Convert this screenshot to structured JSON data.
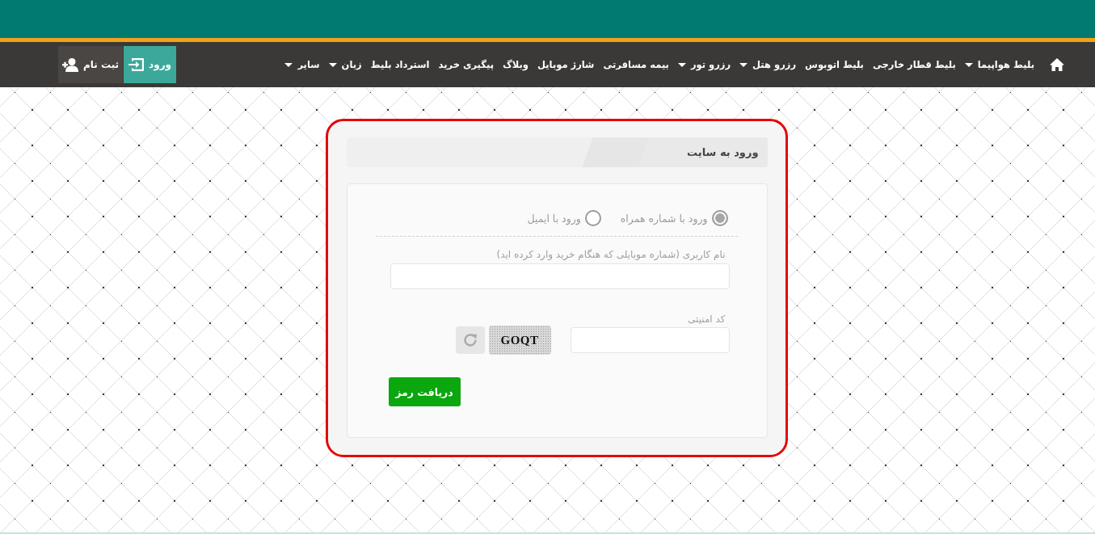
{
  "nav": {
    "items": [
      {
        "kind": "home"
      },
      {
        "kind": "link",
        "label": "بلیط هواپیما",
        "dropdown": true
      },
      {
        "kind": "link",
        "label": "بلیط قطار خارجی",
        "dropdown": false
      },
      {
        "kind": "link",
        "label": "بلیط اتوبوس",
        "dropdown": false
      },
      {
        "kind": "link",
        "label": "رزرو هتل",
        "dropdown": true
      },
      {
        "kind": "link",
        "label": "رزرو تور",
        "dropdown": true
      },
      {
        "kind": "link",
        "label": "بیمه مسافرتی",
        "dropdown": false
      },
      {
        "kind": "link",
        "label": "شارژ موبایل",
        "dropdown": false
      },
      {
        "kind": "link",
        "label": "وبلاگ",
        "dropdown": false
      },
      {
        "kind": "link",
        "label": "پیگیری خرید",
        "dropdown": false
      },
      {
        "kind": "link",
        "label": "استرداد بلیط",
        "dropdown": false
      },
      {
        "kind": "link",
        "label": "زبان",
        "dropdown": true
      },
      {
        "kind": "link",
        "label": "سایر",
        "dropdown": true
      }
    ],
    "buttons": [
      {
        "kind": "login",
        "label": "ورود"
      },
      {
        "kind": "register",
        "label": "ثبت نام"
      }
    ]
  },
  "login_panel": {
    "title": "ورود به سایت",
    "login_methods": [
      {
        "label": "ورود با شماره همراه",
        "selected": true
      },
      {
        "label": "ورود با ایمیل",
        "selected": false
      }
    ],
    "username": {
      "label": "نام کاربری (شماره موبایلی که هنگام خرید وارد کرده اید)"
    },
    "security_code": {
      "label": "کد امنیتی",
      "captcha": "GOQT"
    },
    "submit": "دریافت رمز"
  }
}
